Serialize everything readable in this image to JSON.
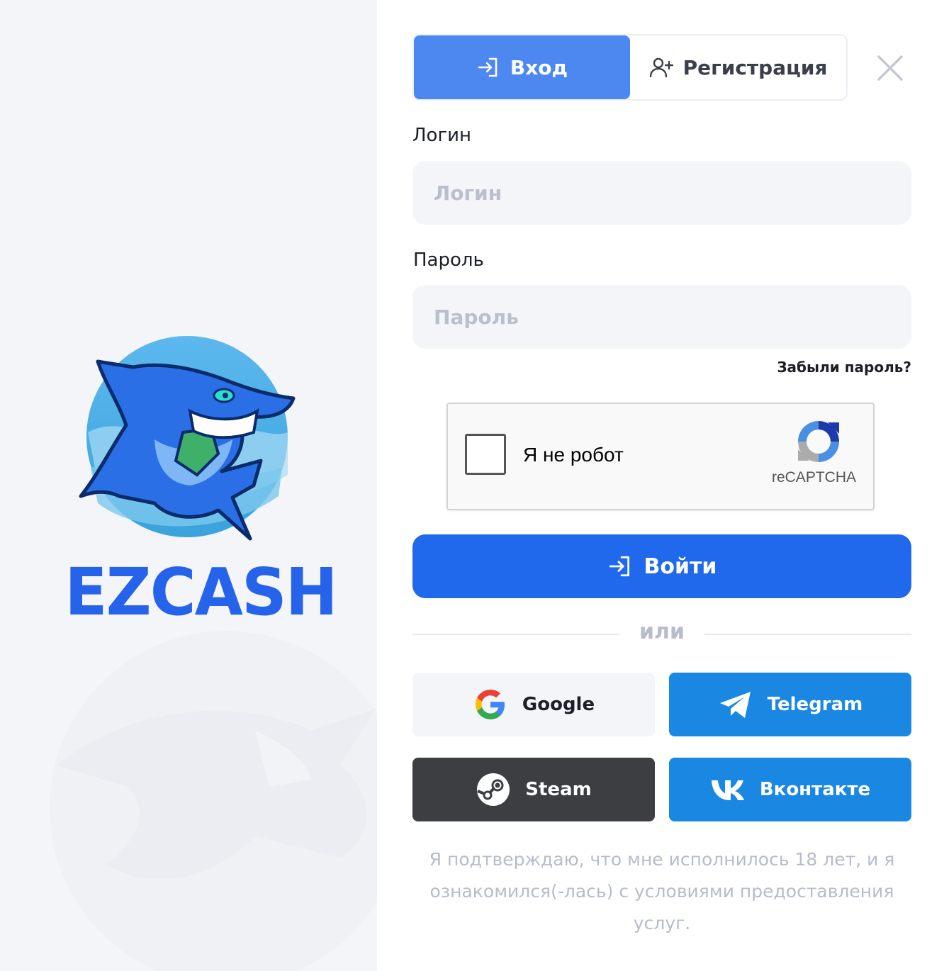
{
  "brand": {
    "name": "EZCASH",
    "color": "#2563eb"
  },
  "tabs": [
    {
      "label": "Вход",
      "icon": "login-arrow-icon",
      "active": true
    },
    {
      "label": "Регистрация",
      "icon": "add-user-icon",
      "active": false
    }
  ],
  "close_icon": "close-icon",
  "form": {
    "login_label": "Логин",
    "login_placeholder": "Логин",
    "login_value": "",
    "password_label": "Пароль",
    "password_placeholder": "Пароль",
    "password_value": "",
    "forgot_label": "Забыли пароль?",
    "submit_label": "Войти",
    "submit_color": "#2169ec"
  },
  "captcha": {
    "checkbox_label": "Я не робот",
    "brand": "reCAPTCHA",
    "checked": false
  },
  "divider": {
    "label": "или"
  },
  "social": {
    "google_label": "Google",
    "telegram_label": "Telegram",
    "steam_label": "Steam",
    "vk_label": "Вконтакте",
    "telegram_color": "#1a87e2",
    "steam_color": "#3c3e42"
  },
  "terms": "Я подтверждаю, что мне исполнилось 18 лет, и я ознакомился(-лась) с условиями предоставления услуг."
}
